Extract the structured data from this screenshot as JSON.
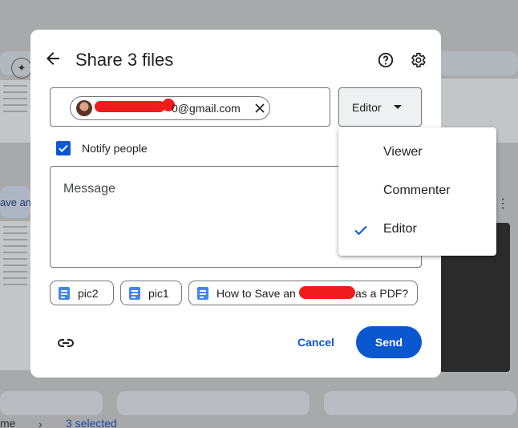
{
  "background": {
    "breadcrumb_partial": "me",
    "selected_text": "3 selected",
    "side_text": "ave an"
  },
  "dialog": {
    "title": "Share 3 files",
    "recipient": {
      "email_visible": "0@gmail.com"
    },
    "role": {
      "selected": "Editor",
      "options": [
        "Viewer",
        "Commenter",
        "Editor"
      ]
    },
    "notify": {
      "label": "Notify people",
      "checked": true
    },
    "message": {
      "placeholder": "Message"
    },
    "files": [
      {
        "name": "pic2"
      },
      {
        "name": "pic1"
      },
      {
        "name_prefix": "How to Save an",
        "name_suffix": "as a PDF?"
      }
    ],
    "buttons": {
      "cancel": "Cancel",
      "send": "Send"
    }
  },
  "colors": {
    "accent": "#0b57d0",
    "redaction": "#ee1c1c",
    "doc_icon": "#4285f4"
  },
  "icons": [
    "back-arrow-icon",
    "help-icon",
    "settings-gear-icon",
    "close-icon",
    "checkbox-icon",
    "doc-icon",
    "link-icon",
    "checkmark-icon",
    "caret-down-icon"
  ]
}
